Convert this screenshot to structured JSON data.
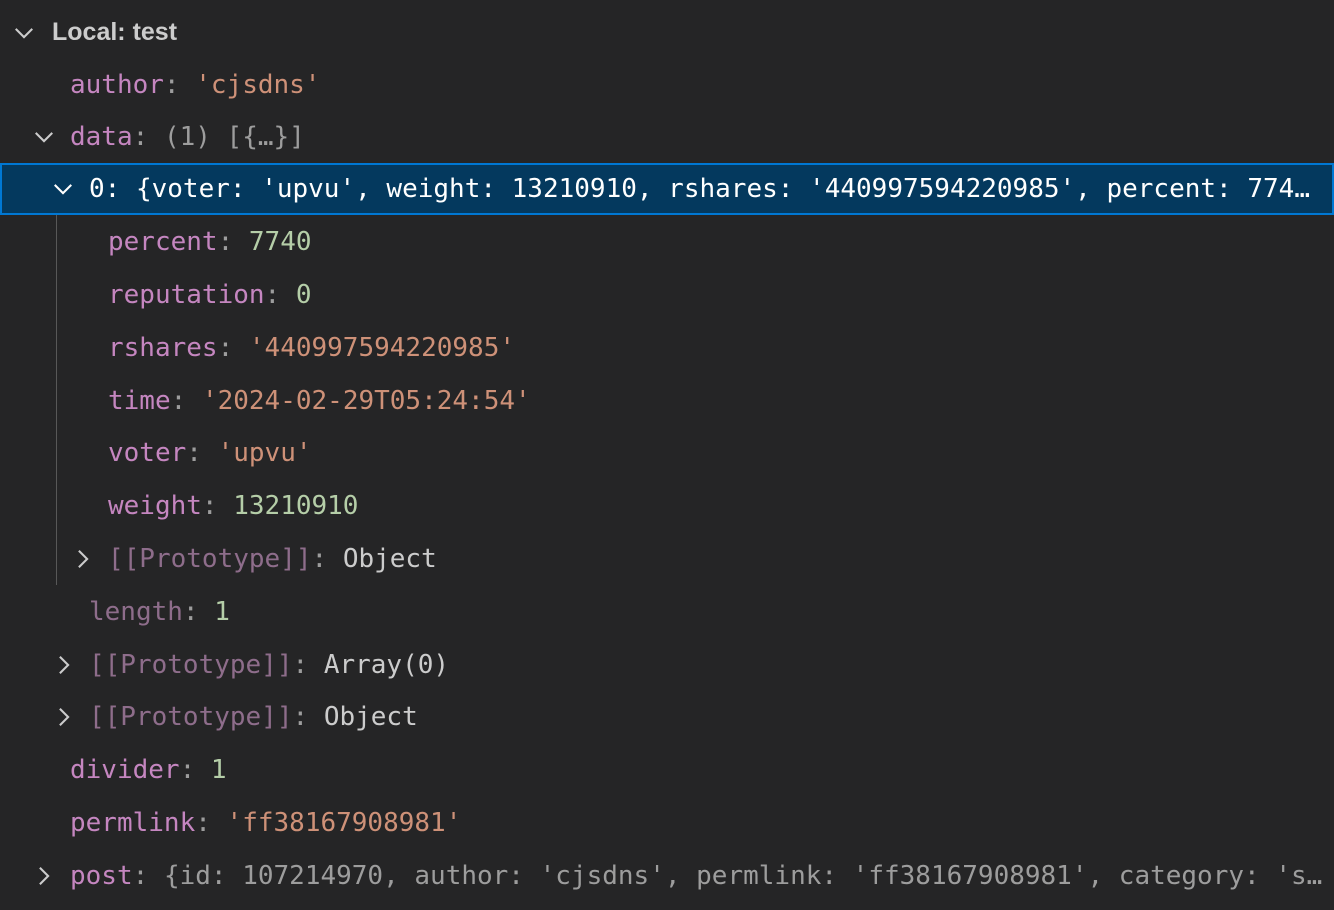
{
  "scope": {
    "title": "Local: test"
  },
  "rows": {
    "author": {
      "key": "author",
      "value": "'cjsdns'"
    },
    "data": {
      "key": "data",
      "value": "(1) [{…}]"
    },
    "item0": {
      "key": "0",
      "value": "{voter: 'upvu', weight: 13210910, rshares: '440997594220985', percent: 774…"
    },
    "percent": {
      "key": "percent",
      "value": "7740"
    },
    "reputation": {
      "key": "reputation",
      "value": "0"
    },
    "rshares": {
      "key": "rshares",
      "value": "'440997594220985'"
    },
    "time": {
      "key": "time",
      "value": "'2024-02-29T05:24:54'"
    },
    "voter": {
      "key": "voter",
      "value": "'upvu'"
    },
    "weight": {
      "key": "weight",
      "value": "13210910"
    },
    "proto_obj_inner": {
      "key": "[[Prototype]]",
      "value": "Object"
    },
    "length": {
      "key": "length",
      "value": "1"
    },
    "proto_array": {
      "key": "[[Prototype]]",
      "value": "Array(0)"
    },
    "proto_obj": {
      "key": "[[Prototype]]",
      "value": "Object"
    },
    "divider": {
      "key": "divider",
      "value": "1"
    },
    "permlink": {
      "key": "permlink",
      "value": "'ff38167908981'"
    },
    "post": {
      "key": "post",
      "value": "{id: 107214970, author: 'cjsdns', permlink: 'ff38167908981', category: 's…"
    }
  },
  "colors": {
    "background": "#252526",
    "selection": "#04395e",
    "selection_border": "#0078d4",
    "key": "#c586c0",
    "string": "#ce9178",
    "number": "#b5cea8"
  }
}
